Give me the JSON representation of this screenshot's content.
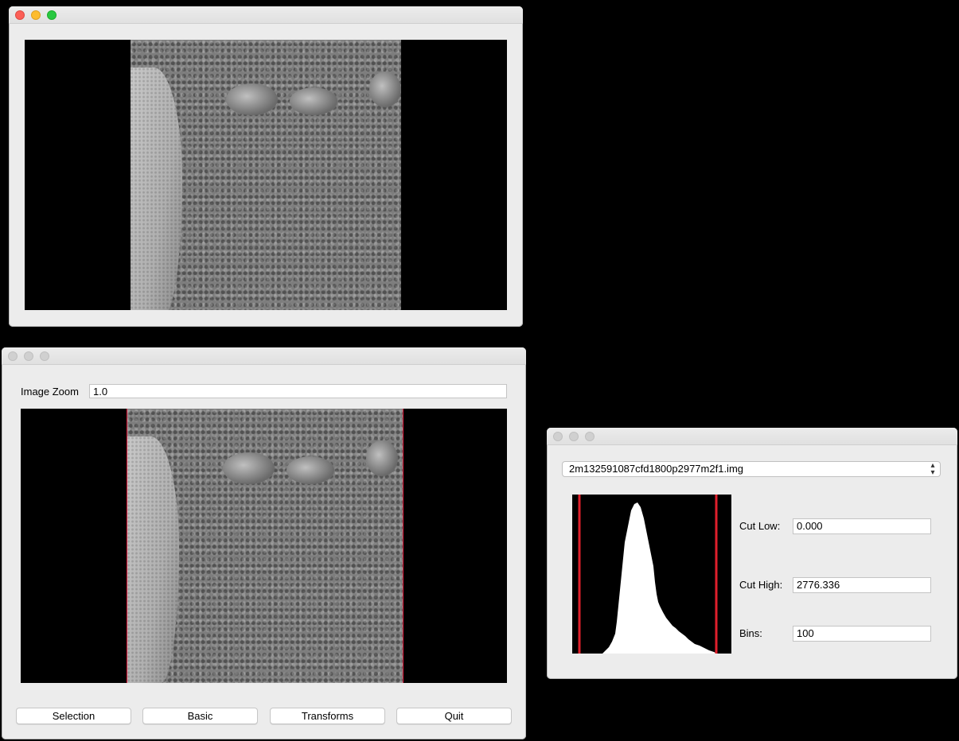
{
  "viewer_window": {
    "image": "Mars surface image"
  },
  "control_window": {
    "zoom": {
      "label": "Image Zoom",
      "value": "1.0"
    },
    "buttons": {
      "selection": "Selection",
      "basic": "Basic",
      "transforms": "Transforms",
      "quit": "Quit"
    }
  },
  "histogram_window": {
    "file": "2m132591087cfd1800p2977m2f1.img",
    "cut_low": {
      "label": "Cut Low:",
      "value": "0.000"
    },
    "cut_high": {
      "label": "Cut High:",
      "value": "2776.336"
    },
    "bins": {
      "label": "Bins:",
      "value": "100"
    }
  },
  "colors": {
    "cut_line": "#e0202c",
    "selection_border": "#e02040"
  },
  "icons": [
    "close-dot",
    "minimize-dot",
    "zoom-dot",
    "chevron-updown-icon"
  ]
}
